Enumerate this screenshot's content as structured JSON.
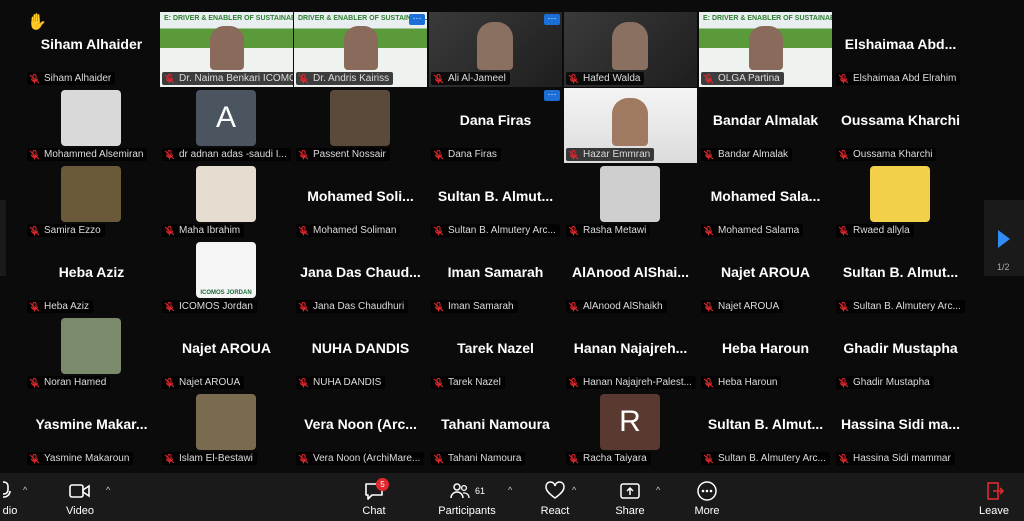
{
  "colors": {
    "accent": "#2f8df5",
    "active_border": "#22c55e",
    "leave": "#e0282e"
  },
  "tiles": [
    {
      "label": "Siham Alhaider",
      "big": "Siham Alhaider",
      "hand": true
    },
    {
      "label": "Dr. Naima Benkari ICOMO...",
      "video": "banner",
      "banner_text": "E: DRIVER & ENABLER OF SUSTAINABILITY"
    },
    {
      "label": "Dr. Andris Kairiss",
      "video": "banner",
      "banner_text": "DRIVER & ENABLER OF SUSTAINABILITY",
      "active": true,
      "more": true
    },
    {
      "label": "Ali Al-Jameel",
      "video": "dark",
      "more": true
    },
    {
      "label": "Hafed Walda",
      "video": "dark"
    },
    {
      "label": "OLGA Partina",
      "video": "banner",
      "banner_text": "E: DRIVER & ENABLER OF SUSTAINABILITY"
    },
    {
      "label": "Elshaimaa Abd Elrahim",
      "big": "Elshaimaa Abd..."
    },
    {
      "label": "Mohammed Alsemiran",
      "avatar": "#d9d9d9"
    },
    {
      "label": "dr adnan adas -saudi I...",
      "letter": "A",
      "letter_bg": "#4a5560"
    },
    {
      "label": "Passent Nossair",
      "avatar": "#5a4a3a"
    },
    {
      "label": "Dana Firas",
      "big": "Dana Firas",
      "more": true
    },
    {
      "label": "Hazar Emmran",
      "video": "light"
    },
    {
      "label": "Bandar Almalak",
      "big": "Bandar Almalak"
    },
    {
      "label": "Oussama Kharchi",
      "big": "Oussama Kharchi"
    },
    {
      "label": "Samira Ezzo",
      "avatar": "#6b5a3a"
    },
    {
      "label": "Maha Ibrahim",
      "avatar": "#e6ddd0"
    },
    {
      "label": "Mohamed Soliman",
      "big": "Mohamed Soli..."
    },
    {
      "label": "Sultan B. Almutery Arc...",
      "big": "Sultan B. Almut..."
    },
    {
      "label": "Rasha Metawi",
      "avatar": "#cfcfcf"
    },
    {
      "label": "Mohamed Salama",
      "big": "Mohamed Sala..."
    },
    {
      "label": "Rwaed allyla",
      "avatar": "#f2d04a"
    },
    {
      "label": "Heba Aziz",
      "big": "Heba Aziz"
    },
    {
      "label": "ICOMOS Jordan",
      "avatar": "#f5f5f5",
      "logo": "ICOMOS JORDAN"
    },
    {
      "label": "Jana Das Chaudhuri",
      "big": "Jana Das Chaud..."
    },
    {
      "label": "Iman Samarah",
      "big": "Iman Samarah"
    },
    {
      "label": "AlAnood AlShaikh",
      "big": "AlAnood AlShai..."
    },
    {
      "label": "Najet AROUA",
      "big": "Najet AROUA"
    },
    {
      "label": "Sultan B. Almutery Arc...",
      "big": "Sultan B. Almut..."
    },
    {
      "label": "Noran Hamed",
      "avatar": "#7a8a6a"
    },
    {
      "label": "Najet AROUA",
      "big": "Najet AROUA"
    },
    {
      "label": "NUHA DANDIS",
      "big": "NUHA DANDIS"
    },
    {
      "label": "Tarek Nazel",
      "big": "Tarek Nazel"
    },
    {
      "label": "Hanan Najajreh-Palest...",
      "big": "Hanan Najajreh..."
    },
    {
      "label": "Heba Haroun",
      "big": "Heba Haroun"
    },
    {
      "label": "Ghadir Mustapha",
      "big": "Ghadir Mustapha"
    },
    {
      "label": "Yasmine Makaroun",
      "big": "Yasmine Makar..."
    },
    {
      "label": "Islam El-Bestawi",
      "avatar": "#7a6a50"
    },
    {
      "label": "Vera Noon (ArchiMare...",
      "big": "Vera Noon (Arc..."
    },
    {
      "label": "Tahani Namoura",
      "big": "Tahani Namoura"
    },
    {
      "label": "Racha Taiyara",
      "letter": "R",
      "letter_bg": "#5a3a30"
    },
    {
      "label": "Sultan B. Almutery Arc...",
      "big": "Sultan B. Almut..."
    },
    {
      "label": "Hassina Sidi mammar",
      "big": "Hassina Sidi ma..."
    }
  ],
  "pager": {
    "label": "1/2"
  },
  "toolbar": {
    "audio": "dio",
    "video": "Video",
    "chat": "Chat",
    "chat_badge": "5",
    "participants": "Participants",
    "participants_count": "61",
    "react": "React",
    "share": "Share",
    "more": "More",
    "leave": "Leave"
  }
}
